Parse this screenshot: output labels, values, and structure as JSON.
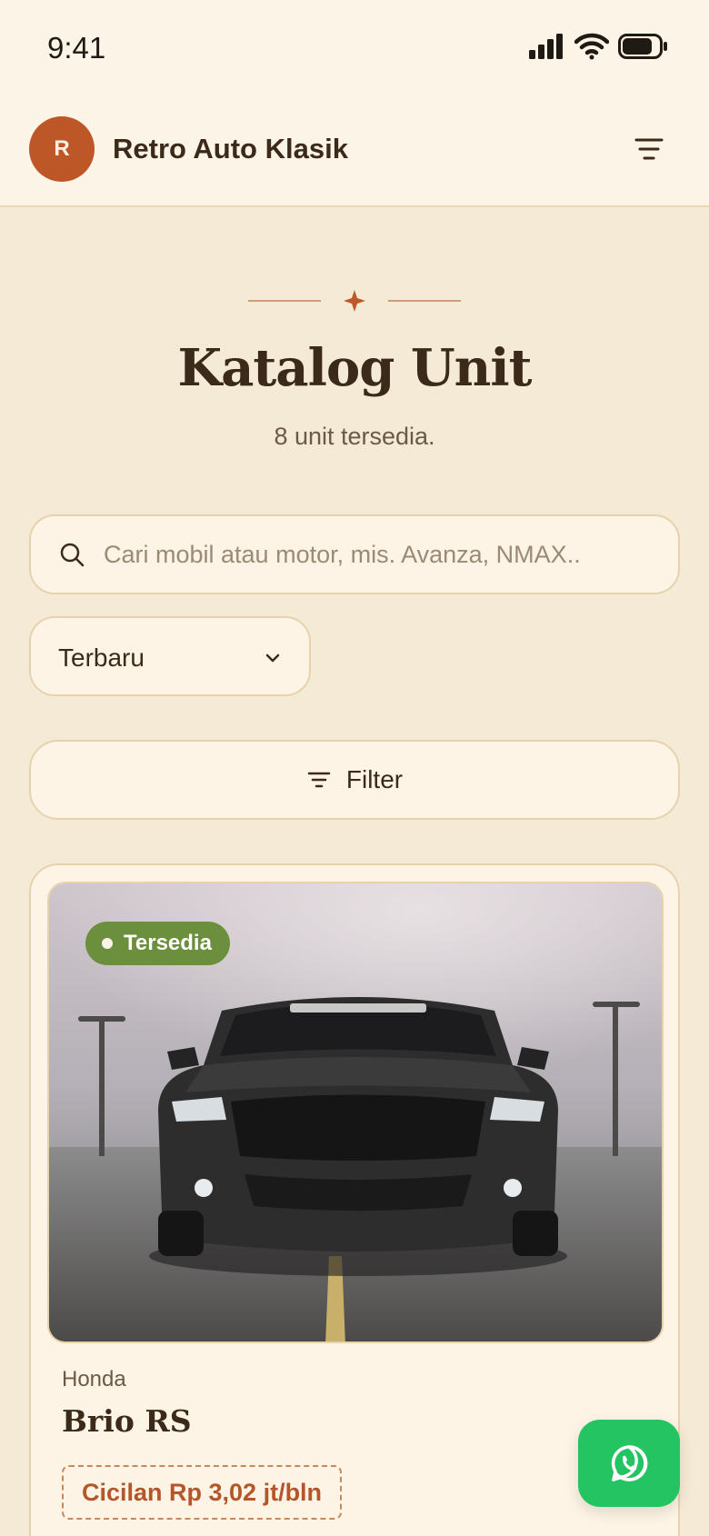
{
  "status_bar": {
    "time": "9:41"
  },
  "header": {
    "avatar_letter": "R",
    "brand": "Retro Auto Klasik",
    "menu_icon": "menu-filter-icon"
  },
  "page": {
    "title": "Katalog Unit",
    "subtitle": "8 unit tersedia."
  },
  "search": {
    "placeholder": "Cari mobil atau motor, mis. Avanza, NMAX..",
    "value": ""
  },
  "sort": {
    "selected": "Terbaru"
  },
  "filter": {
    "label": "Filter"
  },
  "listing": {
    "status": "Tersedia",
    "brand": "Honda",
    "model": "Brio RS",
    "installment": "Cicilan Rp 3,02 jt/bln"
  },
  "colors": {
    "background": "#f5ead6",
    "accent": "#bd5728",
    "available": "#6b8f3c",
    "whatsapp": "#25c463"
  }
}
